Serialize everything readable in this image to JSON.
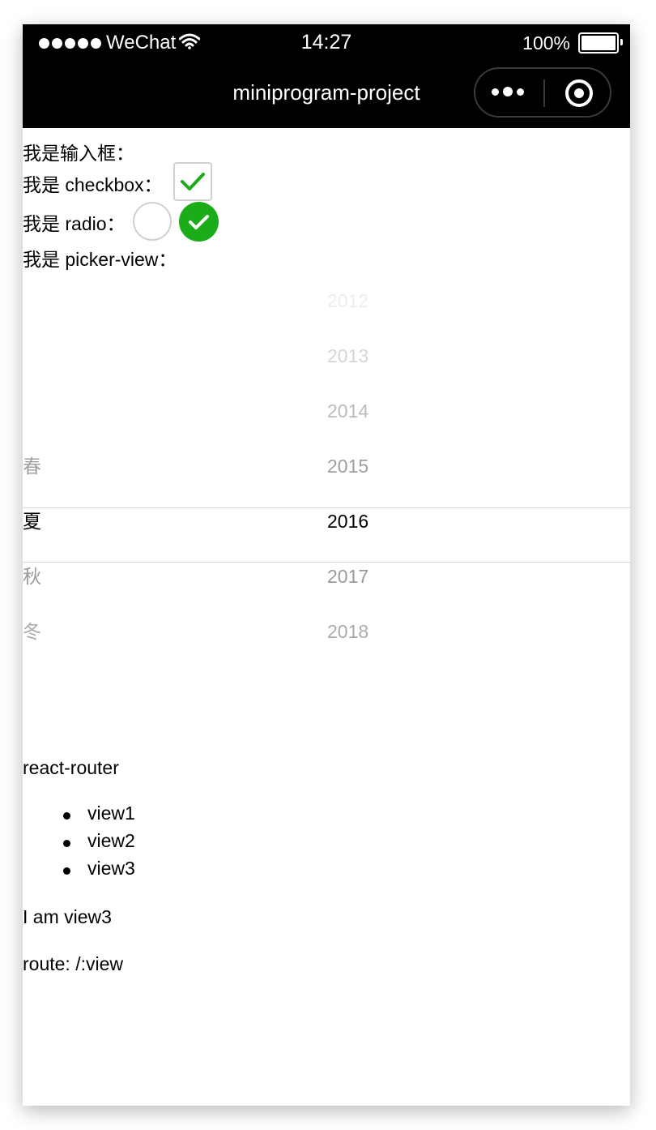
{
  "status_bar": {
    "carrier": "WeChat",
    "time": "14:27",
    "battery": "100%"
  },
  "nav": {
    "title": "miniprogram-project"
  },
  "form": {
    "input_label": "我是输入框：",
    "checkbox_label": "我是 checkbox：",
    "checkbox_checked": true,
    "radio_label": "我是 radio：",
    "radio_options": [
      {
        "checked": false
      },
      {
        "checked": true
      }
    ],
    "picker_label": "我是 picker-view："
  },
  "picker": {
    "seasons": [
      "春",
      "夏",
      "秋",
      "冬"
    ],
    "season_selected": "夏",
    "years": [
      "2012",
      "2013",
      "2014",
      "2015",
      "2016",
      "2017",
      "2018"
    ],
    "year_selected": "2016"
  },
  "router": {
    "title": "react-router",
    "links": [
      "view1",
      "view2",
      "view3"
    ],
    "view_text": "I am view3",
    "route_text": "route: /:view"
  },
  "colors": {
    "nav_bg": "#000000",
    "accent_green": "#1aad19",
    "border_gray": "#d1d1d1"
  }
}
